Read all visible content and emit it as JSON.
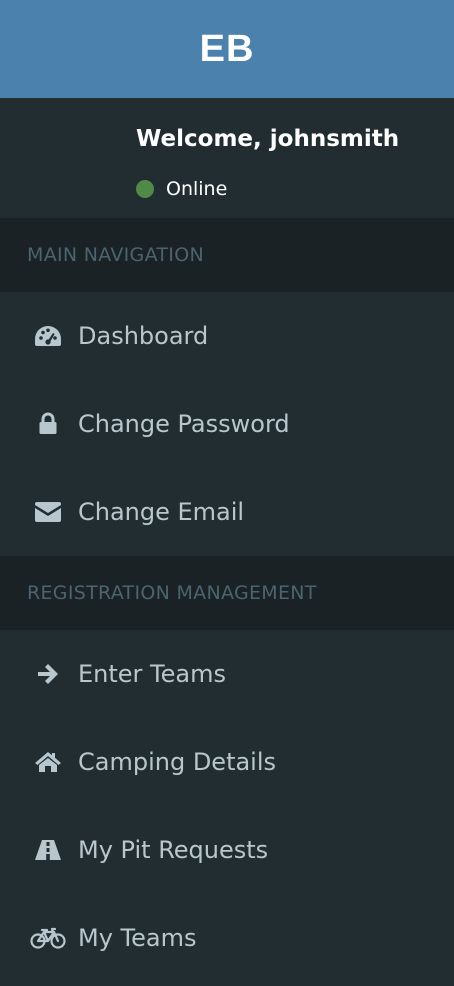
{
  "brand": {
    "logo_text": "EB"
  },
  "user": {
    "welcome": "Welcome, johnsmith",
    "status": "Online",
    "status_color": "#4f8a48"
  },
  "colors": {
    "brand": "#4a82ad",
    "sidebar_bg": "#222d32",
    "header_bg": "#1a2226",
    "menu_text": "#b8c7ce",
    "header_text": "#4b646f"
  },
  "sections": [
    {
      "header": "MAIN NAVIGATION",
      "items": [
        {
          "label": "Dashboard",
          "icon": "dashboard-icon"
        },
        {
          "label": "Change Password",
          "icon": "lock-icon"
        },
        {
          "label": "Change Email",
          "icon": "envelope-icon"
        }
      ]
    },
    {
      "header": "REGISTRATION MANAGEMENT",
      "items": [
        {
          "label": "Enter Teams",
          "icon": "arrow-right-icon"
        },
        {
          "label": "Camping Details",
          "icon": "home-icon"
        },
        {
          "label": "My Pit Requests",
          "icon": "road-icon"
        },
        {
          "label": "My Teams",
          "icon": "bicycle-icon"
        }
      ]
    }
  ]
}
